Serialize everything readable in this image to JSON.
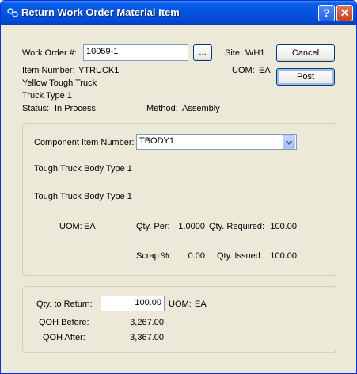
{
  "window": {
    "title": "Return Work Order Material Item",
    "help": "?",
    "close": "✕",
    "icon": "gear-icon"
  },
  "header": {
    "work_order_label": "Work Order #:",
    "work_order_value": "10059-1",
    "lookup_label": "...",
    "site_label": "Site:",
    "site_value": "WH1",
    "uom_label": "UOM:",
    "uom_value": "EA",
    "item_number_label": "Item Number:",
    "item_number_value": "YTRUCK1",
    "description1": "Yellow Tough Truck",
    "description2": "Truck Type 1",
    "status_label": "Status:",
    "status_value": "In Process",
    "method_label": "Method:",
    "method_value": "Assembly"
  },
  "buttons": {
    "cancel": "Cancel",
    "post": "Post"
  },
  "component": {
    "label": "Component Item Number:",
    "selected": "TBODY1",
    "description1": "Tough Truck Body Type 1",
    "description2": "Tough Truck Body Type 1",
    "uom_label": "UOM:",
    "uom_value": "EA",
    "qty_per_label": "Qty. Per:",
    "qty_per_value": "1.0000",
    "qty_required_label": "Qty. Required:",
    "qty_required_value": "100.00",
    "scrap_label": "Scrap %:",
    "scrap_value": "0.00",
    "qty_issued_label": "Qty. Issued:",
    "qty_issued_value": "100.00"
  },
  "return": {
    "qty_label": "Qty. to Return:",
    "qty_value": "100.00",
    "uom_label": "UOM:",
    "uom_value": "EA",
    "qoh_before_label": "QOH Before:",
    "qoh_before_value": "3,267.00",
    "qoh_after_label": "QOH After:",
    "qoh_after_value": "3,367.00"
  }
}
